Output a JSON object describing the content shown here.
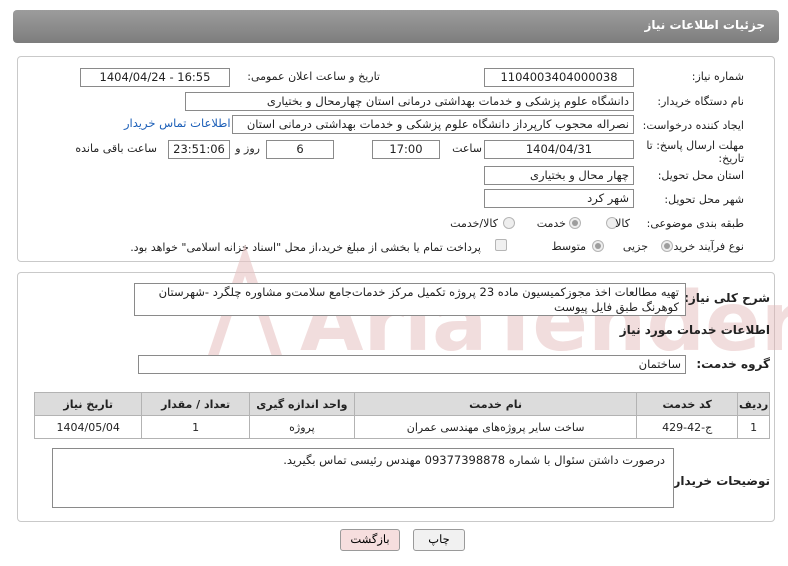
{
  "header": {
    "title": "جزئیات اطلاعات نیاز"
  },
  "fields": {
    "need_number_label": "شماره نیاز:",
    "need_number": "1104003404000038",
    "announce_label": "تاریخ و ساعت اعلان عمومی:",
    "announce_value": "1404/04/24 - 16:55",
    "buyer_org_label": "نام دستگاه خریدار:",
    "buyer_org": "دانشگاه علوم پزشکی و خدمات بهداشتی درمانی استان چهارمحال و بختیاری",
    "creator_label": "ایجاد کننده درخواست:",
    "creator": "نصراله محجوب کارپرداز دانشگاه علوم پزشکی و خدمات بهداشتی درمانی استان",
    "contact_link": "اطلاعات تماس خریدار",
    "deadline_label_1": "مهلت ارسال پاسخ: تا",
    "deadline_label_2": "تاریخ:",
    "deadline_date": "1404/04/31",
    "time_label": "ساعت",
    "deadline_time": "17:00",
    "days_value": "6",
    "days_label": "روز و",
    "remaining_time": "23:51:06",
    "remaining_label": "ساعت باقی مانده",
    "province_label": "استان محل تحویل:",
    "province": "چهار محال و بختیاری",
    "city_label": "شهر محل تحویل:",
    "city": "شهر کرد",
    "category_label": "طبقه بندی موضوعی:",
    "category_options": [
      "کالا",
      "خدمت",
      "کالا/خدمت"
    ],
    "category_selected": 1,
    "process_label": "نوع فرآیند خرید :",
    "process_options": [
      "جزیی",
      "متوسط"
    ],
    "process_selected": 0,
    "payment_note": "پرداخت تمام یا بخشی از مبلغ خرید،از محل \"اسناد خزانه اسلامی\" خواهد بود."
  },
  "summary": {
    "label": "شرح کلی نیاز:",
    "text": "تهیه مطالعات اخذ مجوزکمیسیون ماده 23 پروژه تکمیل مرکز خدمات‌جامع سلامت‌و مشاوره چلگرد -شهرستان کوهرنگ طبق فایل پیوست"
  },
  "services": {
    "section_title": "اطلاعات خدمات مورد نیاز",
    "group_label": "گروه خدمت:",
    "group_value": "ساختمان",
    "columns": [
      "ردیف",
      "کد خدمت",
      "نام خدمت",
      "واحد اندازه گیری",
      "تعداد / مقدار",
      "تاریخ نیاز"
    ],
    "rows": [
      [
        "1",
        "ج-42-429",
        "ساخت سایر پروژه‌های مهندسی عمران",
        "پروژه",
        "1",
        "1404/05/04"
      ]
    ]
  },
  "buyer_notes": {
    "label": "توضیحات خریدار:",
    "text": "درصورت داشتن سئوال با شماره 09377398878 مهندس رئیسی تماس بگیرید."
  },
  "buttons": {
    "print": "چاپ",
    "back": "بازگشت"
  },
  "watermark": {
    "text": "AriaTender.neT"
  },
  "colors": {
    "header": "#8a8a8a",
    "link": "#1c5fb8",
    "back_button": "#f6dede",
    "watermark": "#d9a3a3"
  }
}
